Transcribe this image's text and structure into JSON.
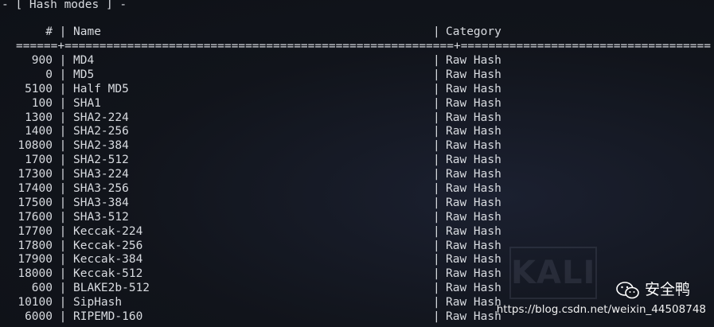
{
  "heading": "- [ Hash modes ] -",
  "columns": {
    "num": "#",
    "name": "Name",
    "category": "Category"
  },
  "separator": "======+========================================================+====================================",
  "rows": [
    {
      "num": "900",
      "name": "MD4",
      "category": "Raw Hash"
    },
    {
      "num": "0",
      "name": "MD5",
      "category": "Raw Hash"
    },
    {
      "num": "5100",
      "name": "Half MD5",
      "category": "Raw Hash"
    },
    {
      "num": "100",
      "name": "SHA1",
      "category": "Raw Hash"
    },
    {
      "num": "1300",
      "name": "SHA2-224",
      "category": "Raw Hash"
    },
    {
      "num": "1400",
      "name": "SHA2-256",
      "category": "Raw Hash"
    },
    {
      "num": "10800",
      "name": "SHA2-384",
      "category": "Raw Hash"
    },
    {
      "num": "1700",
      "name": "SHA2-512",
      "category": "Raw Hash"
    },
    {
      "num": "17300",
      "name": "SHA3-224",
      "category": "Raw Hash"
    },
    {
      "num": "17400",
      "name": "SHA3-256",
      "category": "Raw Hash"
    },
    {
      "num": "17500",
      "name": "SHA3-384",
      "category": "Raw Hash"
    },
    {
      "num": "17600",
      "name": "SHA3-512",
      "category": "Raw Hash"
    },
    {
      "num": "17700",
      "name": "Keccak-224",
      "category": "Raw Hash"
    },
    {
      "num": "17800",
      "name": "Keccak-256",
      "category": "Raw Hash"
    },
    {
      "num": "17900",
      "name": "Keccak-384",
      "category": "Raw Hash"
    },
    {
      "num": "18000",
      "name": "Keccak-512",
      "category": "Raw Hash"
    },
    {
      "num": "600",
      "name": "BLAKE2b-512",
      "category": "Raw Hash"
    },
    {
      "num": "10100",
      "name": "SipHash",
      "category": "Raw Hash"
    },
    {
      "num": "6000",
      "name": "RIPEMD-160",
      "category": "Raw Hash"
    }
  ],
  "background_logo": "KALI",
  "watermark": {
    "brand": "安全鸭",
    "url": "https://blog.csdn.net/weixin_44508748",
    "icon": "wechat-icon"
  },
  "colors": {
    "background": "#11141b",
    "text": "#d8dbe0"
  }
}
